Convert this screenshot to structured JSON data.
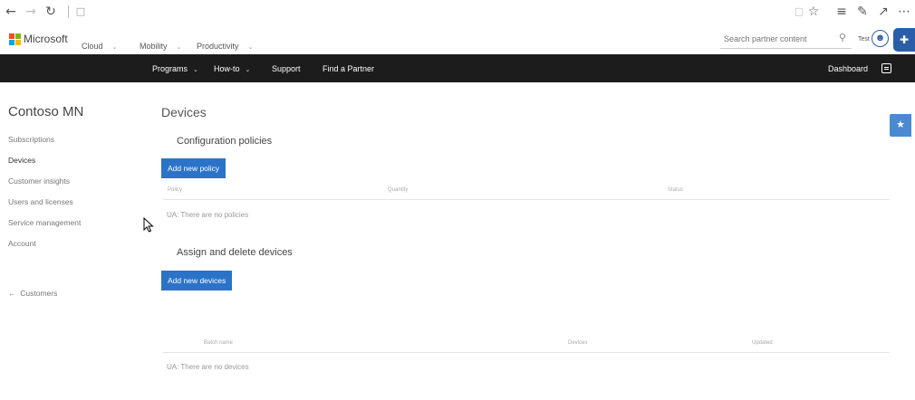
{
  "browser": {
    "icons": [
      "back-arrow",
      "forward-arrow",
      "refresh",
      "lock",
      "reading-view",
      "favorite-star",
      "hub",
      "pen",
      "share",
      "more"
    ]
  },
  "header": {
    "brand": "Microsoft",
    "nav": [
      {
        "label": "Cloud"
      },
      {
        "label": "Mobility"
      },
      {
        "label": "Productivity"
      }
    ],
    "search": {
      "placeholder": "Search partner content",
      "value": ""
    },
    "user_label": "Test"
  },
  "navbar": {
    "items": [
      {
        "label": "Programs",
        "dropdown": true
      },
      {
        "label": "How-to",
        "dropdown": true
      },
      {
        "label": "Support",
        "dropdown": false
      },
      {
        "label": "Find a Partner",
        "dropdown": false
      }
    ],
    "right_label": "Dashboard"
  },
  "sidebar": {
    "title": "Contoso MN",
    "items": [
      {
        "label": "Subscriptions",
        "active": false
      },
      {
        "label": "Devices",
        "active": true
      },
      {
        "label": "Customer insights",
        "active": false
      },
      {
        "label": "Users and licenses",
        "active": false
      },
      {
        "label": "Service management",
        "active": false
      },
      {
        "label": "Account",
        "active": false
      }
    ],
    "back_link": "Customers"
  },
  "main": {
    "title": "Devices",
    "config": {
      "title": "Configuration policies",
      "button": "Add new policy",
      "columns": [
        "Policy",
        "Quantity",
        "Status"
      ],
      "empty": "UA: There are no policies"
    },
    "assign": {
      "title": "Assign and delete devices",
      "button": "Add new devices",
      "columns": [
        "Batch name",
        "Devices",
        "Updated"
      ],
      "empty": "UA: There are no devices"
    }
  },
  "colors": {
    "navbar_bg": "#1c1c1c",
    "button_bg": "#2b73c8",
    "accent": "#2b5ea8"
  }
}
